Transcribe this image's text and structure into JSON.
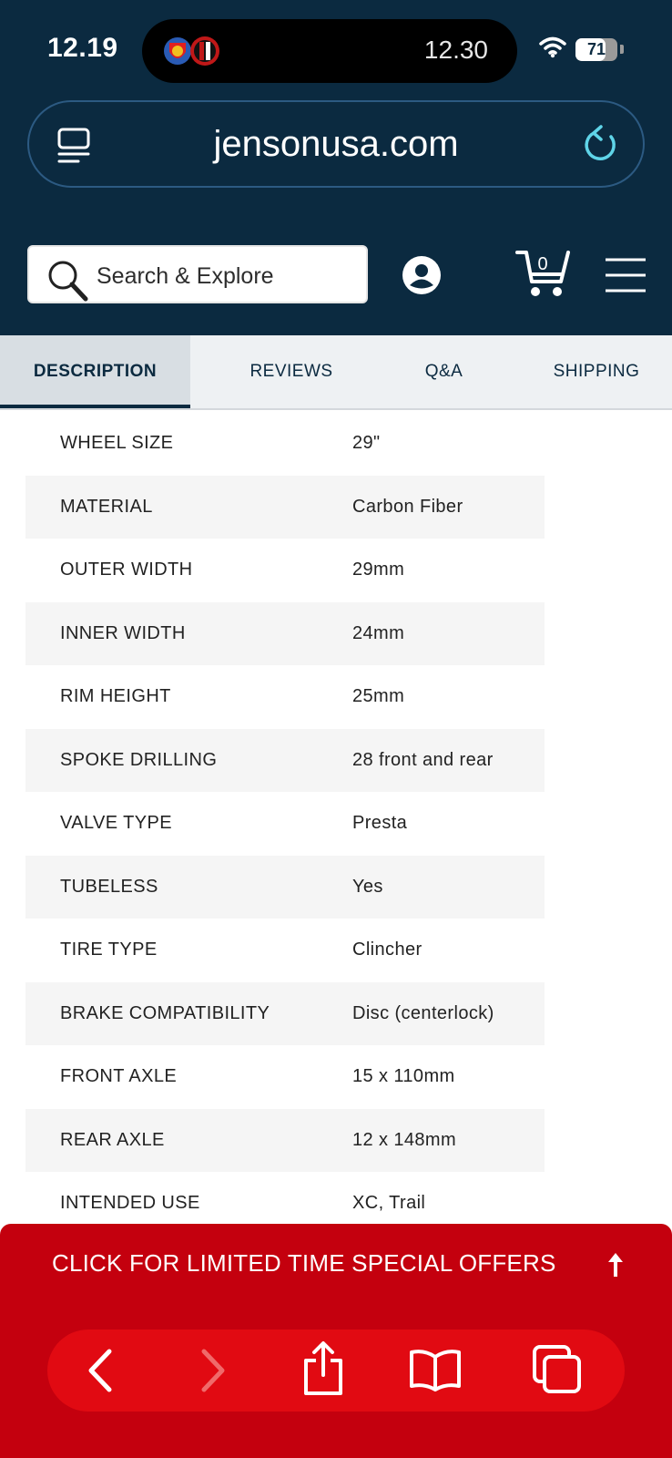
{
  "status_bar": {
    "time": "12.19",
    "island_time": "12.30",
    "battery": "71",
    "battery_level": 0.71
  },
  "browser": {
    "url": "jensonusa.com"
  },
  "header": {
    "search_placeholder": "Search & Explore",
    "cart_count": "0"
  },
  "tabs": [
    {
      "label": "DESCRIPTION",
      "active": true
    },
    {
      "label": "REVIEWS"
    },
    {
      "label": "Q&A"
    },
    {
      "label": "SHIPPING"
    }
  ],
  "specs": [
    {
      "key": "WHEEL SIZE",
      "value": "29\""
    },
    {
      "key": "MATERIAL",
      "value": "Carbon Fiber"
    },
    {
      "key": "OUTER WIDTH",
      "value": "29mm"
    },
    {
      "key": "INNER WIDTH",
      "value": "24mm"
    },
    {
      "key": "RIM HEIGHT",
      "value": "25mm"
    },
    {
      "key": "SPOKE DRILLING",
      "value": "28 front and rear"
    },
    {
      "key": "VALVE TYPE",
      "value": "Presta"
    },
    {
      "key": "TUBELESS",
      "value": "Yes"
    },
    {
      "key": "TIRE TYPE",
      "value": "Clincher"
    },
    {
      "key": "BRAKE COMPATIBILITY",
      "value": "Disc (centerlock)"
    },
    {
      "key": "FRONT AXLE",
      "value": "15 x 110mm"
    },
    {
      "key": "REAR AXLE",
      "value": "12 x 148mm"
    },
    {
      "key": "INTENDED USE",
      "value": "XC, Trail"
    }
  ],
  "offer_banner": {
    "text": "CLICK FOR LIMITED TIME SPECIAL OFFERS"
  },
  "colors": {
    "header_bg": "#0b2a40",
    "offer_red": "#c4000e",
    "toolbar_red": "#e10a12"
  }
}
